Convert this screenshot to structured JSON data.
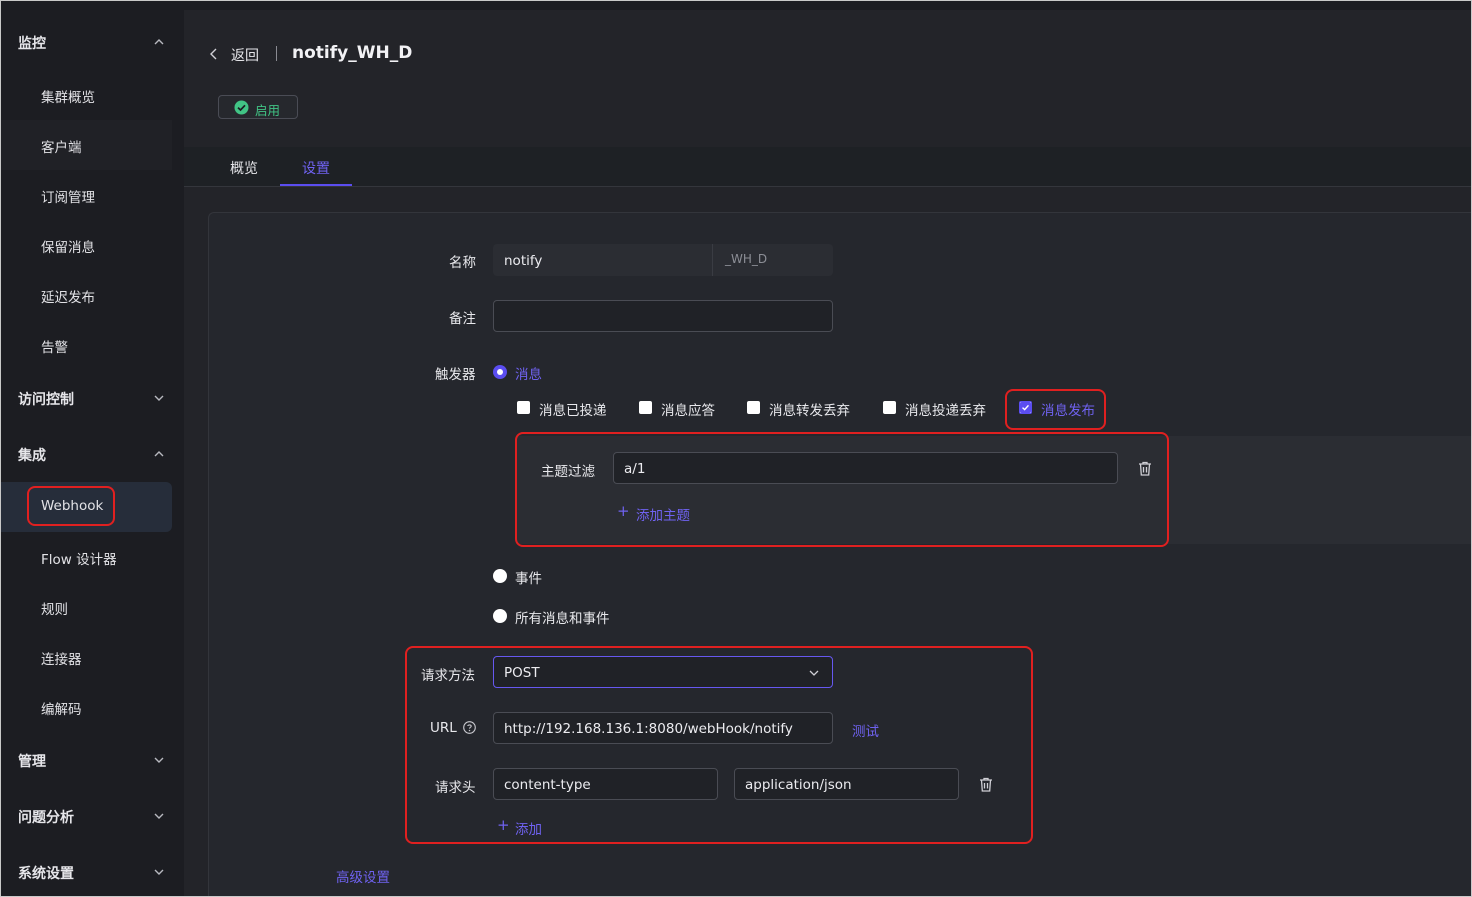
{
  "sidebar": {
    "groups": {
      "monitor": "监控",
      "access": "访问控制",
      "integration": "集成",
      "manage": "管理",
      "diagnose": "问题分析",
      "system": "系统设置"
    },
    "monitor_items": [
      "集群概览",
      "客户端",
      "订阅管理",
      "保留消息",
      "延迟发布",
      "告警"
    ],
    "integration_items": [
      "Webhook",
      "Flow 设计器",
      "规则",
      "连接器",
      "编解码"
    ]
  },
  "header": {
    "back_label": "返回",
    "title": "notify_WH_D",
    "status_label": "启用"
  },
  "tabs": [
    "概览",
    "设置"
  ],
  "form": {
    "name_label": "名称",
    "name_value": "notify",
    "name_suffix": "_WH_D",
    "note_label": "备注",
    "note_value": "",
    "trigger_label": "触发器",
    "trigger_options": {
      "message": "消息",
      "event": "事件",
      "all": "所有消息和事件"
    },
    "message_types": [
      "消息已投递",
      "消息应答",
      "消息转发丢弃",
      "消息投递丢弃",
      "消息发布"
    ],
    "topic_filter_label": "主题过滤",
    "topic_filter_value": "a/1",
    "add_topic_label": "添加主题",
    "method_label": "请求方法",
    "method_value": "POST",
    "url_label": "URL",
    "url_value": "http://192.168.136.1:8080/webHook/notify",
    "test_label": "测试",
    "headers_label": "请求头",
    "header_key": "content-type",
    "header_value": "application/json",
    "add_header_label": "添加",
    "advanced_label": "高级设置"
  },
  "colors": {
    "accent": "#5b4df0",
    "success": "#41c485",
    "highlight": "#e02020"
  }
}
